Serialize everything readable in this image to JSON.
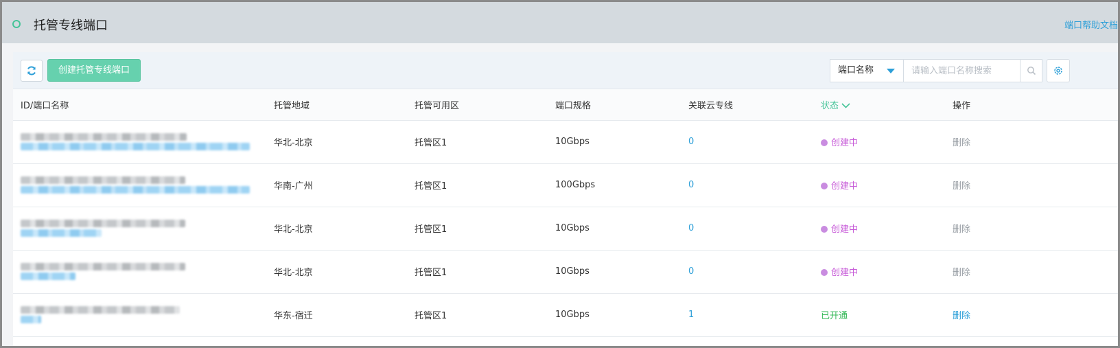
{
  "header": {
    "title": "托管专线端口",
    "help_link": "端口帮助文档"
  },
  "toolbar": {
    "create_label": "创建托管专线端口",
    "search_field_selected": "端口名称",
    "search_placeholder": "请输入端口名称搜索"
  },
  "table": {
    "columns": [
      "ID/端口名称",
      "托管地域",
      "托管可用区",
      "端口规格",
      "关联云专线",
      "状态",
      "操作"
    ],
    "rows": [
      {
        "region": "华北-北京",
        "zone": "托管区1",
        "spec": "10Gbps",
        "linked": "0",
        "status": "创建中",
        "op": "删除"
      },
      {
        "region": "华南-广州",
        "zone": "托管区1",
        "spec": "100Gbps",
        "linked": "0",
        "status": "创建中",
        "op": "删除"
      },
      {
        "region": "华北-北京",
        "zone": "托管区1",
        "spec": "10Gbps",
        "linked": "0",
        "status": "创建中",
        "op": "删除"
      },
      {
        "region": "华北-北京",
        "zone": "托管区1",
        "spec": "10Gbps",
        "linked": "0",
        "status": "创建中",
        "op": "删除"
      },
      {
        "region": "华东-宿迁",
        "zone": "托管区1",
        "spec": "10Gbps",
        "linked": "1",
        "status": "已开通",
        "op": "删除"
      }
    ]
  },
  "colors": {
    "accent_green": "#46c499",
    "create_button": "#66d1ae",
    "link_blue": "#2d9fd8",
    "status_creating": "#c75bd8",
    "status_open": "#33b856"
  }
}
